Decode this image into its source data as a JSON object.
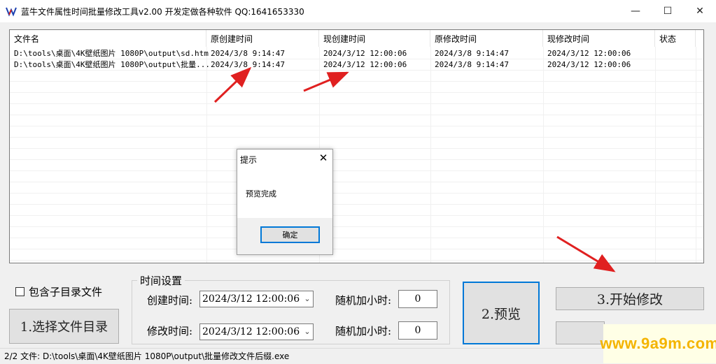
{
  "window": {
    "title": "蓝牛文件属性时间批量修改工具v2.00   开发定做各种软件   QQ:1641653330",
    "controls": {
      "minimize": "—",
      "maximize": "☐",
      "close": "✕"
    }
  },
  "list": {
    "columns": [
      "文件名",
      "原创建时间",
      "现创建时间",
      "原修改时间",
      "现修改时间",
      "状态"
    ],
    "rows": [
      [
        "D:\\tools\\桌面\\4K壁纸图片 1080P\\output\\sd.htm",
        "2024/3/8 9:14:47",
        "2024/3/12 12:00:06",
        "2024/3/8 9:14:47",
        "2024/3/12 12:00:06",
        ""
      ],
      [
        "D:\\tools\\桌面\\4K壁纸图片 1080P\\output\\批量...",
        "2024/3/8 9:14:47",
        "2024/3/12 12:00:06",
        "2024/3/8 9:14:47",
        "2024/3/12 12:00:06",
        ""
      ]
    ]
  },
  "dialog": {
    "title": "提示",
    "close": "✕",
    "message": "预览完成",
    "ok": "确定"
  },
  "controls": {
    "include_subdirs": "包含子目录文件",
    "select_dir_button": "1.选择文件目录",
    "group_title": "时间设置",
    "create_time_label": "创建时间:",
    "create_time_value": "2024/3/12 12:00:06",
    "modify_time_label": "修改时间:",
    "modify_time_value": "2024/3/12 12:00:06",
    "random_hours_label_1": "随机加小时:",
    "random_hours_value_1": "0",
    "random_hours_label_2": "随机加小时:",
    "random_hours_value_2": "0",
    "preview_button": "2.预览",
    "start_button": "3.开始修改"
  },
  "statusbar": {
    "text": "2/2 文件:  D:\\tools\\桌面\\4K壁纸图片 1080P\\output\\批量修改文件后缀.exe"
  },
  "watermark": {
    "text": "www.9a9m.com"
  },
  "colors": {
    "accent": "#0078d7",
    "arrow": "#e02020",
    "watermark": "#f4b400"
  }
}
